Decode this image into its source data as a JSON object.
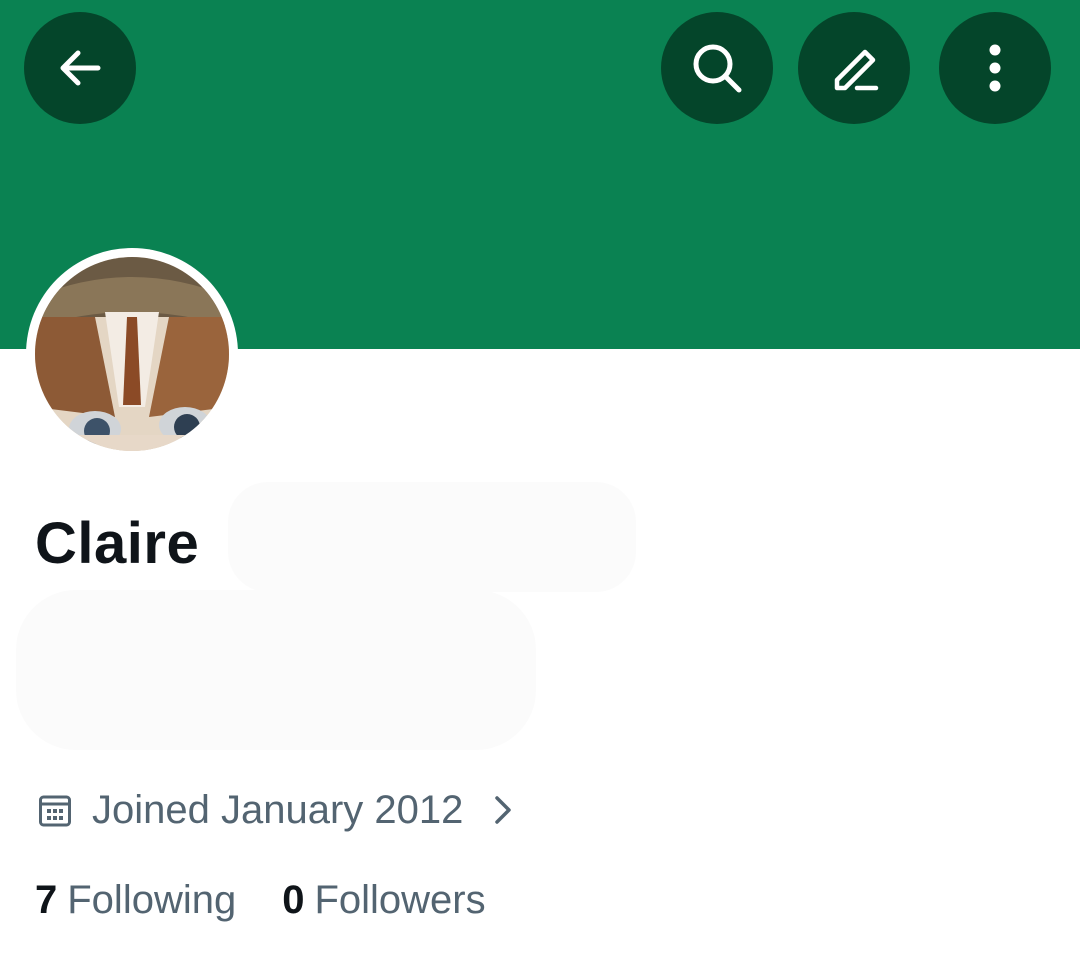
{
  "header": {
    "banner_color": "#0a8252",
    "button_color": "#04452a",
    "back_icon": "arrow-left-icon",
    "search_icon": "search-icon",
    "edit_icon": "pencil-icon",
    "more_icon": "more-vertical-icon"
  },
  "profile": {
    "display_name": "Claire",
    "joined_text": "Joined January 2012",
    "following_count": "7",
    "following_label": "Following",
    "followers_count": "0",
    "followers_label": "Followers"
  }
}
